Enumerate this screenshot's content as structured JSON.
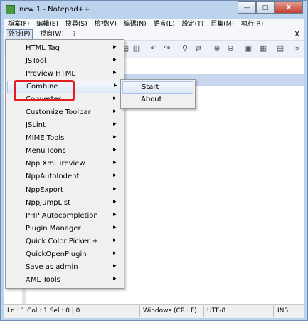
{
  "window": {
    "title": "new 1 - Notepad++",
    "minimize": "—",
    "maximize": "□",
    "close": "X"
  },
  "menubar": {
    "row1": [
      "檔案(F)",
      "編輯(E)",
      "搜尋(S)",
      "檢視(V)",
      "編碼(N)",
      "語言(L)",
      "設定(T)",
      "巨集(M)",
      "執行(R)"
    ],
    "row2": {
      "plugins": "外掛(P)",
      "window": "視窗(W)",
      "help": "?",
      "close_doc": "X"
    }
  },
  "toolbar": {
    "overflow": "»"
  },
  "plugins_menu": {
    "items": [
      {
        "label": "HTML Tag"
      },
      {
        "label": "JSTool"
      },
      {
        "label": "Preview HTML"
      },
      {
        "label": "Combine"
      },
      {
        "label": "Converter"
      },
      {
        "label": "Customize Toolbar"
      },
      {
        "label": "JSLint"
      },
      {
        "label": "MIME Tools"
      },
      {
        "label": "Menu Icons"
      },
      {
        "label": "Npp Xml Treview"
      },
      {
        "label": "NppAutoIndent"
      },
      {
        "label": "NppExport"
      },
      {
        "label": "NppJumpList"
      },
      {
        "label": "PHP Autocompletion"
      },
      {
        "label": "Plugin Manager"
      },
      {
        "label": "Quick Color Picker +"
      },
      {
        "label": "QuickOpenPlugin"
      },
      {
        "label": "Save as admin"
      },
      {
        "label": "XML Tools"
      }
    ],
    "arrow": "▸"
  },
  "combine_submenu": {
    "items": [
      "Start",
      "About"
    ]
  },
  "statusbar": {
    "position": "Ln : 1    Col : 1    Sel : 0 | 0",
    "eol": "Windows (CR LF)",
    "encoding": "UTF-8",
    "mode": "INS"
  }
}
